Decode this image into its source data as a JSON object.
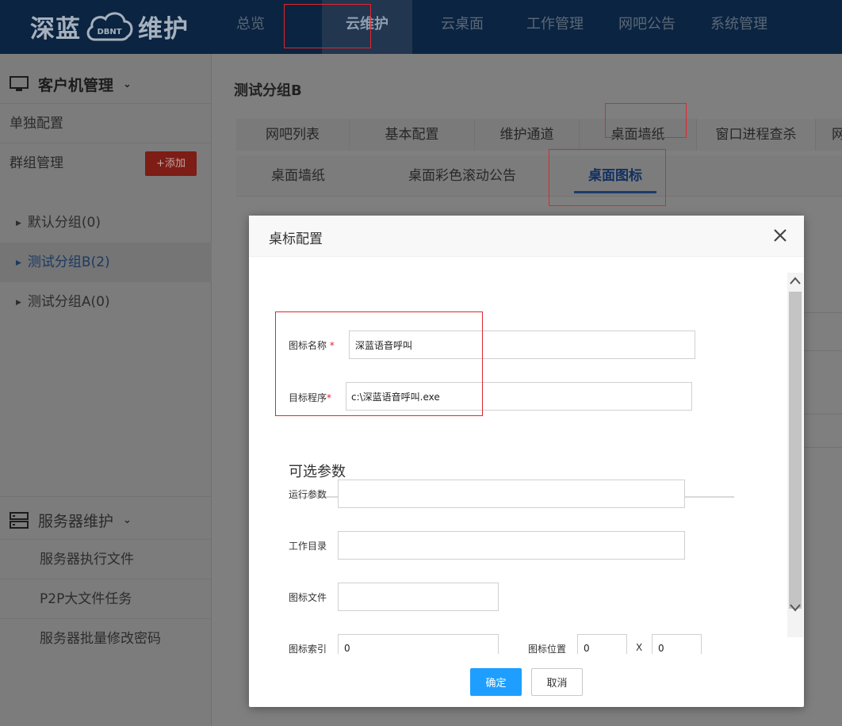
{
  "app": {
    "logo_left": "深蓝",
    "logo_badge": "DBNT",
    "logo_right": "维护"
  },
  "nav": {
    "items": [
      "总览",
      "云维护",
      "云桌面",
      "工作管理",
      "网吧公告",
      "系统管理"
    ],
    "active": "云维护"
  },
  "sidebar": {
    "client_header": "客户机管理",
    "single_config": "单独配置",
    "group_manage": "群组管理",
    "add_button": "+添加",
    "groups": [
      "默认分组(0)",
      "测试分组B(2)",
      "测试分组A(0)"
    ],
    "selected_group": "测试分组B(2)",
    "server_header": "服务器维护",
    "server_items": [
      "服务器执行文件",
      "P2P大文件任务",
      "服务器批量修改密码"
    ]
  },
  "content": {
    "group_title": "测试分组B",
    "main_tabs": [
      "网吧列表",
      "基本配置",
      "维护通道",
      "桌面墙纸",
      "窗口进程查杀",
      "网"
    ],
    "sub_tabs": [
      "桌面墙纸",
      "桌面彩色滚动公告",
      "桌面图标"
    ],
    "active_sub_tab": "桌面图标"
  },
  "modal": {
    "title": "桌标配置",
    "fields": {
      "icon_name": {
        "label": "图标名称",
        "required_mark": "*",
        "value": "深蓝语音呼叫"
      },
      "target": {
        "label": "目标程序",
        "required_mark": "*",
        "value": "c:\\深蓝语音呼叫.exe"
      },
      "optional_section": "可选参数",
      "run_params": {
        "label": "运行参数",
        "value": ""
      },
      "work_dir": {
        "label": "工作目录",
        "value": ""
      },
      "icon_file": {
        "label": "图标文件",
        "value": ""
      },
      "icon_index": {
        "label": "图标索引",
        "value": "0"
      },
      "icon_position": {
        "label": "图标位置",
        "x_value": "0",
        "separator": "X",
        "y_value": "0"
      }
    },
    "ok_button": "确定",
    "cancel_button": "取消"
  },
  "colors": {
    "topbar": "#0b2441",
    "primary_button": "#1e9fff",
    "annotation_red": "#e0262c",
    "add_button": "#7d1d16"
  }
}
